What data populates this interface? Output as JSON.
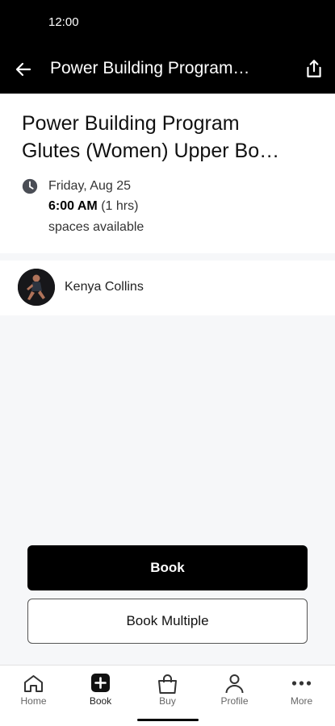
{
  "status_bar": {
    "time": "12:00"
  },
  "app_bar": {
    "title": "Power Building Program…"
  },
  "class": {
    "title_line1": "Power Building Program",
    "title_line2": "Glutes (Women) Upper Bo…",
    "date": "Friday, Aug 25",
    "time": "6:00 AM",
    "duration": "(1 hrs)",
    "availability": "spaces available"
  },
  "instructor": {
    "name": "Kenya Collins"
  },
  "actions": {
    "book_label": "Book",
    "book_multiple_label": "Book Multiple"
  },
  "tab_bar": {
    "items": [
      {
        "label": "Home",
        "icon": "home-icon"
      },
      {
        "label": "Book",
        "icon": "plus-square-icon"
      },
      {
        "label": "Buy",
        "icon": "shopping-bag-icon"
      },
      {
        "label": "Profile",
        "icon": "person-icon"
      },
      {
        "label": "More",
        "icon": "more-dots-icon"
      }
    ]
  },
  "colors": {
    "header_bg": "#000000",
    "primary_button": "#000000",
    "page_bg": "#f6f7f9"
  }
}
